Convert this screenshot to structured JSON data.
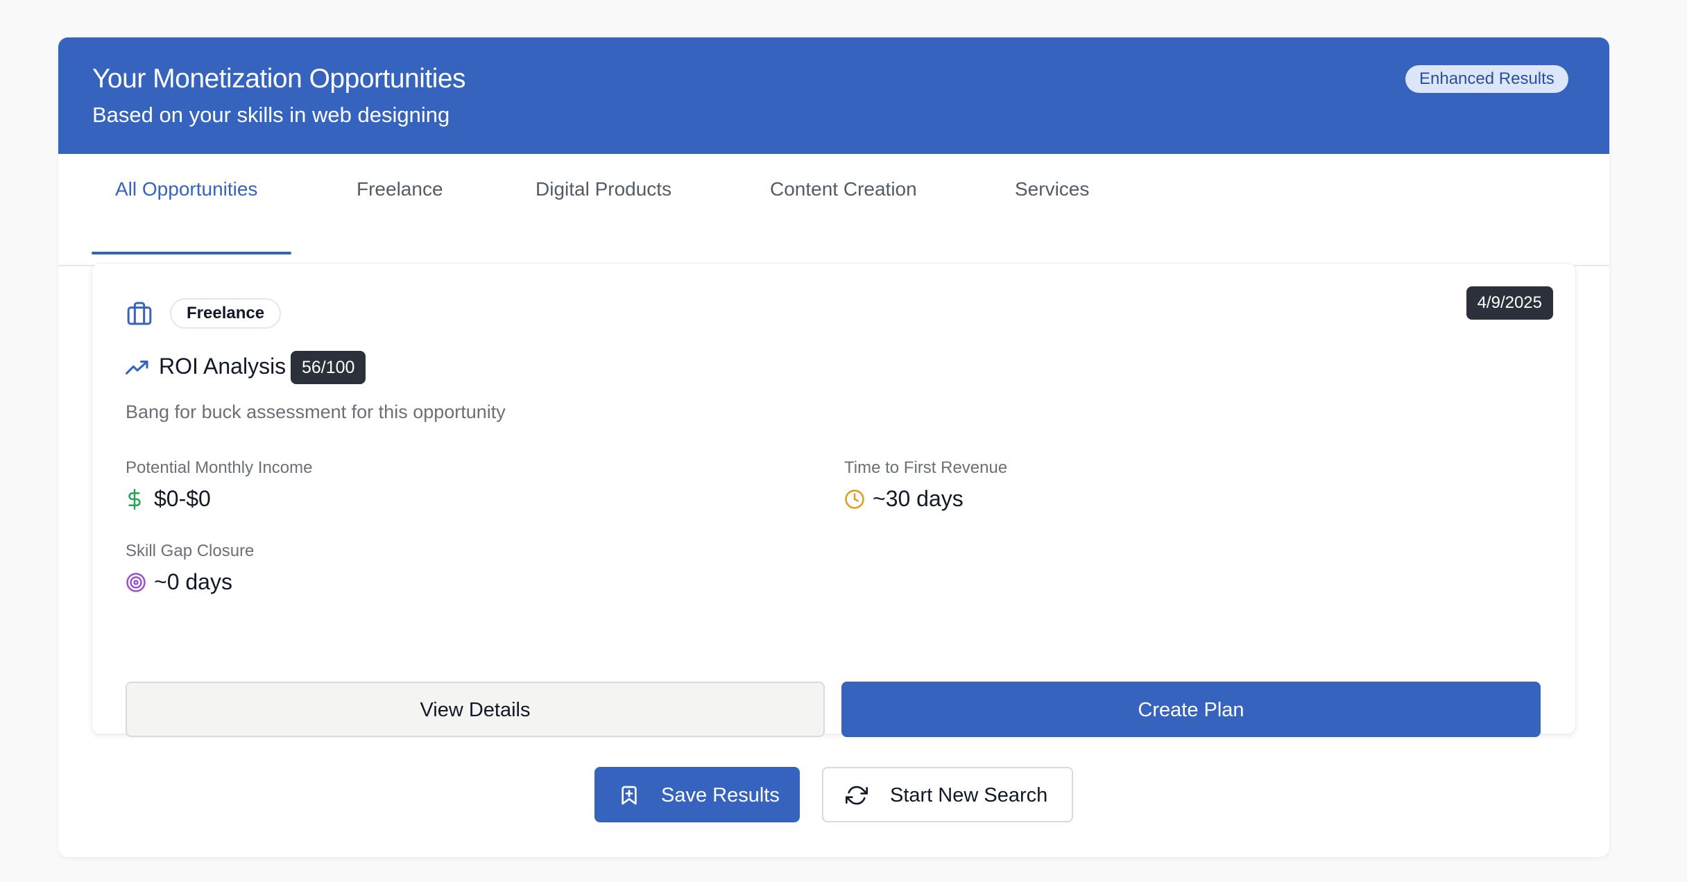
{
  "colors": {
    "primary": "#3563bd",
    "dark_badge": "#2b303a",
    "income_icon": "#22a650",
    "time_icon": "#e29a1f",
    "skill_icon": "#9b4fd1"
  },
  "header": {
    "title": "Your Monetization Opportunities",
    "subtitle": "Based on your skills in web designing",
    "badge": "Enhanced Results"
  },
  "tabs": [
    {
      "label": "All Opportunities",
      "active": true
    },
    {
      "label": "Freelance",
      "active": false
    },
    {
      "label": "Digital Products",
      "active": false
    },
    {
      "label": "Content Creation",
      "active": false
    },
    {
      "label": "Services",
      "active": false
    }
  ],
  "card": {
    "category_icon": "briefcase-icon",
    "category": "Freelance",
    "date": "4/9/2025",
    "roi": {
      "icon": "trending-up-icon",
      "title": "ROI Analysis",
      "score": "56/100",
      "description": "Bang for buck assessment for this opportunity"
    },
    "metrics": {
      "income": {
        "label": "Potential Monthly Income",
        "value": "$0-$0",
        "icon": "dollar-icon"
      },
      "time": {
        "label": "Time to First Revenue",
        "value": "~30 days",
        "icon": "clock-icon"
      },
      "skill": {
        "label": "Skill Gap Closure",
        "value": "~0 days",
        "icon": "target-icon"
      }
    },
    "actions": {
      "view_details": "View Details",
      "create_plan": "Create Plan"
    }
  },
  "footer": {
    "save": {
      "label": "Save Results",
      "icon": "bookmark-plus-icon"
    },
    "new_search": {
      "label": "Start New Search",
      "icon": "refresh-icon"
    }
  }
}
